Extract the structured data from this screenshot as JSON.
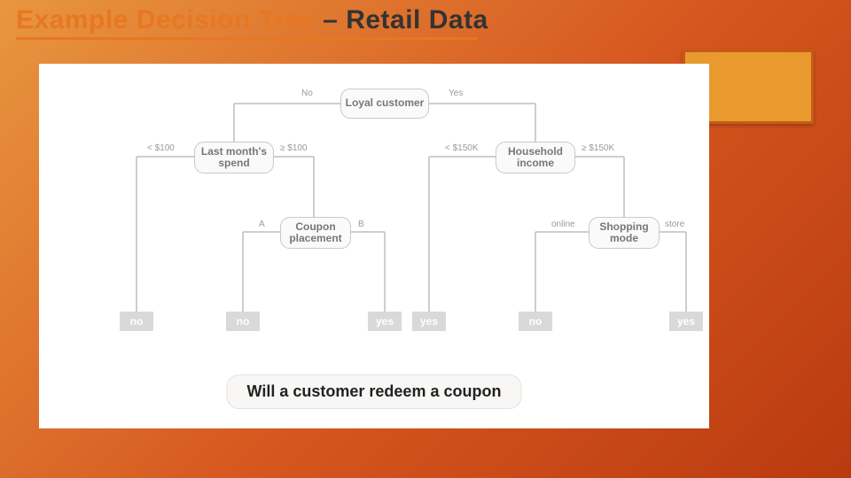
{
  "title_main": "Example Decision Tree ",
  "title_sep": "– ",
  "title_tail": "Retail Data",
  "root": "Loyal customer",
  "root_left": "No",
  "root_right": "Yes",
  "n_spend": "Last month's spend",
  "spend_left": "< $100",
  "spend_right": "≥ $100",
  "n_coupon": "Coupon placement",
  "coupon_left": "A",
  "coupon_right": "B",
  "n_income": "Household income",
  "income_left": "< $150K",
  "income_right": "≥ $150K",
  "n_mode": "Shopping mode",
  "mode_left": "online",
  "mode_right": "store",
  "leaf_no": "no",
  "leaf_yes": "yes",
  "caption": "Will a customer redeem a coupon"
}
